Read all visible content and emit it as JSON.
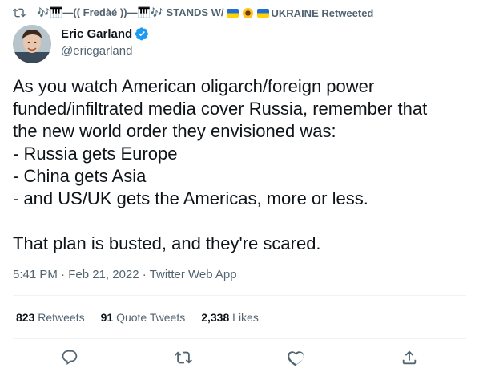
{
  "retweet": {
    "prefix": "🎶🎹—(( Fredàé ))—🎹🎶 STANDS W/",
    "suffix": " UKRAINE Retweeted"
  },
  "author": {
    "name": "Eric Garland",
    "handle": "@ericgarland"
  },
  "tweet": {
    "lines": [
      "As you watch American oligarch/foreign power",
      "funded/infiltrated media cover Russia, remember that",
      "the new world order they envisioned was:",
      "- Russia gets Europe",
      "- China gets Asia",
      "- and US/UK gets the Americas, more or less.",
      "",
      "That plan is busted, and they're scared."
    ],
    "timestamp": "5:41 PM · Feb 21, 2022 · Twitter Web App"
  },
  "stats": {
    "retweets_count": "823",
    "retweets_label": "Retweets",
    "quotes_count": "91",
    "quotes_label": "Quote Tweets",
    "likes_count": "2,338",
    "likes_label": "Likes"
  },
  "colors": {
    "text": "#0f1419",
    "secondary": "#536471",
    "verified": "#1d9bf0",
    "divider": "#eff3f4"
  }
}
